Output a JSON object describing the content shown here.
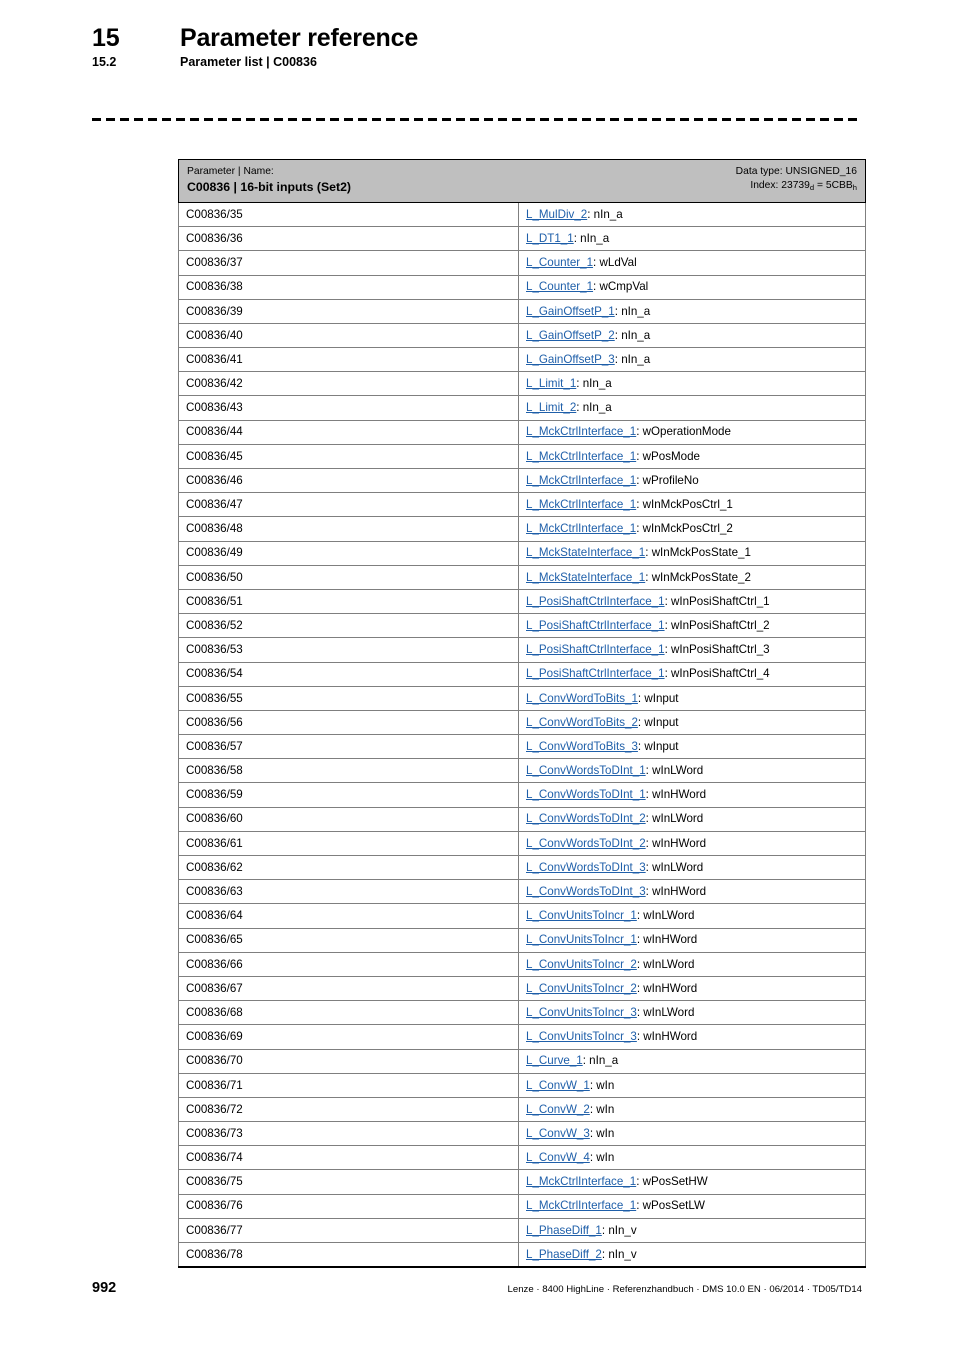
{
  "header": {
    "chapter_number": "15",
    "chapter_title": "Parameter reference",
    "section_number": "15.2",
    "section_title": "Parameter list | C00836"
  },
  "table": {
    "header": {
      "left_label": "Parameter | Name:",
      "left_code": "C00836 | 16-bit inputs (Set2)",
      "data_type": "Data type: UNSIGNED_16",
      "index_prefix": "Index: 23739",
      "index_sub_dec": "d",
      "index_middle": " = 5CBB",
      "index_sub_hex": "h"
    },
    "rows": [
      {
        "parameter": "C00836/35",
        "link": "L_MulDiv_2",
        "separator": ": ",
        "port": "nIn_a"
      },
      {
        "parameter": "C00836/36",
        "link": "L_DT1_1",
        "separator": ": ",
        "port": "nIn_a"
      },
      {
        "parameter": "C00836/37",
        "link": "L_Counter_1",
        "separator": ": ",
        "port": "wLdVal"
      },
      {
        "parameter": "C00836/38",
        "link": "L_Counter_1",
        "separator": ": ",
        "port": "wCmpVal"
      },
      {
        "parameter": "C00836/39",
        "link": "L_GainOffsetP_1",
        "separator": ": ",
        "port": "nIn_a"
      },
      {
        "parameter": "C00836/40",
        "link": "L_GainOffsetP_2",
        "separator": ": ",
        "port": "nIn_a"
      },
      {
        "parameter": "C00836/41",
        "link": "L_GainOffsetP_3",
        "separator": ": ",
        "port": "nIn_a"
      },
      {
        "parameter": "C00836/42",
        "link": "L_Limit_1",
        "separator": ": ",
        "port": "nIn_a"
      },
      {
        "parameter": "C00836/43",
        "link": "L_Limit_2",
        "separator": ": ",
        "port": "nIn_a"
      },
      {
        "parameter": "C00836/44",
        "link": "L_MckCtrlInterface_1",
        "separator": ": ",
        "port": "wOperationMode"
      },
      {
        "parameter": "C00836/45",
        "link": "L_MckCtrlInterface_1",
        "separator": ": ",
        "port": "wPosMode"
      },
      {
        "parameter": "C00836/46",
        "link": "L_MckCtrlInterface_1",
        "separator": ": ",
        "port": "wProfileNo"
      },
      {
        "parameter": "C00836/47",
        "link": "L_MckCtrlInterface_1",
        "separator": ": ",
        "port": "wInMckPosCtrl_1"
      },
      {
        "parameter": "C00836/48",
        "link": "L_MckCtrlInterface_1",
        "separator": ": ",
        "port": "wInMckPosCtrl_2"
      },
      {
        "parameter": "C00836/49",
        "link": "L_MckStateInterface_1",
        "separator": ": ",
        "port": "wInMckPosState_1"
      },
      {
        "parameter": "C00836/50",
        "link": "L_MckStateInterface_1",
        "separator": ": ",
        "port": "wInMckPosState_2"
      },
      {
        "parameter": "C00836/51",
        "link": "L_PosiShaftCtrlInterface_1",
        "separator": ": ",
        "port": "wInPosiShaftCtrl_1"
      },
      {
        "parameter": "C00836/52",
        "link": "L_PosiShaftCtrlInterface_1",
        "separator": ": ",
        "port": "wInPosiShaftCtrl_2"
      },
      {
        "parameter": "C00836/53",
        "link": "L_PosiShaftCtrlInterface_1",
        "separator": ": ",
        "port": "wInPosiShaftCtrl_3"
      },
      {
        "parameter": "C00836/54",
        "link": "L_PosiShaftCtrlInterface_1",
        "separator": ": ",
        "port": "wInPosiShaftCtrl_4"
      },
      {
        "parameter": "C00836/55",
        "link": "L_ConvWordToBits_1",
        "separator": ": ",
        "port": "wInput"
      },
      {
        "parameter": "C00836/56",
        "link": "L_ConvWordToBits_2",
        "separator": ": ",
        "port": "wInput"
      },
      {
        "parameter": "C00836/57",
        "link": "L_ConvWordToBits_3",
        "separator": ": ",
        "port": "wInput"
      },
      {
        "parameter": "C00836/58",
        "link": "L_ConvWordsToDInt_1",
        "separator": ": ",
        "port": "wInLWord"
      },
      {
        "parameter": "C00836/59",
        "link": "L_ConvWordsToDInt_1",
        "separator": ": ",
        "port": "wInHWord"
      },
      {
        "parameter": "C00836/60",
        "link": "L_ConvWordsToDInt_2",
        "separator": ": ",
        "port": "wInLWord"
      },
      {
        "parameter": "C00836/61",
        "link": "L_ConvWordsToDInt_2",
        "separator": ": ",
        "port": "wInHWord"
      },
      {
        "parameter": "C00836/62",
        "link": "L_ConvWordsToDInt_3",
        "separator": ": ",
        "port": "wInLWord"
      },
      {
        "parameter": "C00836/63",
        "link": "L_ConvWordsToDInt_3",
        "separator": ": ",
        "port": "wInHWord"
      },
      {
        "parameter": "C00836/64",
        "link": "L_ConvUnitsToIncr_1",
        "separator": ": ",
        "port": "wInLWord"
      },
      {
        "parameter": "C00836/65",
        "link": "L_ConvUnitsToIncr_1",
        "separator": ": ",
        "port": "wInHWord"
      },
      {
        "parameter": "C00836/66",
        "link": "L_ConvUnitsToIncr_2",
        "separator": ": ",
        "port": "wInLWord"
      },
      {
        "parameter": "C00836/67",
        "link": "L_ConvUnitsToIncr_2",
        "separator": ": ",
        "port": "wInHWord"
      },
      {
        "parameter": "C00836/68",
        "link": "L_ConvUnitsToIncr_3",
        "separator": ": ",
        "port": "wInLWord"
      },
      {
        "parameter": "C00836/69",
        "link": "L_ConvUnitsToIncr_3",
        "separator": ": ",
        "port": "wInHWord"
      },
      {
        "parameter": "C00836/70",
        "link": "L_Curve_1",
        "separator": ": ",
        "port": "nIn_a"
      },
      {
        "parameter": "C00836/71",
        "link": "L_ConvW_1",
        "separator": ": ",
        "port": "wIn"
      },
      {
        "parameter": "C00836/72",
        "link": "L_ConvW_2",
        "separator": ": ",
        "port": "wIn"
      },
      {
        "parameter": "C00836/73",
        "link": "L_ConvW_3",
        "separator": ": ",
        "port": "wIn"
      },
      {
        "parameter": "C00836/74",
        "link": "L_ConvW_4",
        "separator": ": ",
        "port": "wIn"
      },
      {
        "parameter": "C00836/75",
        "link": "L_MckCtrlInterface_1",
        "separator": ": ",
        "port": "wPosSetHW"
      },
      {
        "parameter": "C00836/76",
        "link": "L_MckCtrlInterface_1",
        "separator": ": ",
        "port": "wPosSetLW"
      },
      {
        "parameter": "C00836/77",
        "link": "L_PhaseDiff_1",
        "separator": ": ",
        "port": "nIn_v"
      },
      {
        "parameter": "C00836/78",
        "link": "L_PhaseDiff_2",
        "separator": ": ",
        "port": "nIn_v"
      }
    ]
  },
  "footer": {
    "page_number": "992",
    "text": "Lenze · 8400 HighLine · Referenzhandbuch · DMS 10.0 EN · 06/2014 · TD05/TD14"
  },
  "colors": {
    "link": "#1f5fa9",
    "header_fill": "#bfbfbf",
    "grid": "#7f7f7f"
  }
}
